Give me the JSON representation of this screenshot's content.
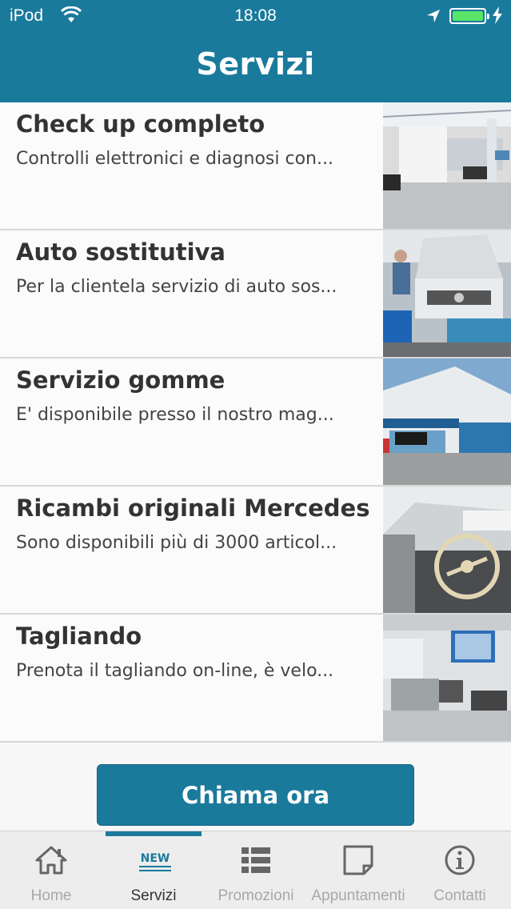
{
  "status_bar": {
    "carrier": "iPod",
    "time": "18:08"
  },
  "header": {
    "title": "Servizi"
  },
  "services": [
    {
      "name": "Check up completo",
      "description": "Controlli elettronici e diagnosi con..."
    },
    {
      "name": "Auto sostitutiva",
      "description": "Per la clientela servizio di auto sos..."
    },
    {
      "name": "Servizio gomme",
      "description": "E' disponibile presso il nostro mag..."
    },
    {
      "name": "Ricambi originali Mercedes",
      "description": "Sono disponibili più di 3000 articol..."
    },
    {
      "name": "Tagliando",
      "description": "Prenota il tagliando on-line, è velo..."
    }
  ],
  "call_button": {
    "label": "Chiama ora"
  },
  "tabs": [
    {
      "label": "Home",
      "icon": "home-icon"
    },
    {
      "label": "Servizi",
      "icon": "new-badge-icon",
      "badge": "NEW",
      "active": true
    },
    {
      "label": "Promozioni",
      "icon": "list-icon"
    },
    {
      "label": "Appuntamenti",
      "icon": "note-icon"
    },
    {
      "label": "Contatti",
      "icon": "info-icon"
    }
  ],
  "colors": {
    "brand": "#1a7a9c",
    "battery": "#59e36a"
  }
}
